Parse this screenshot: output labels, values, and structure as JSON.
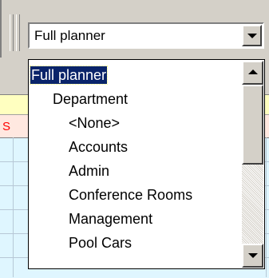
{
  "planner_view": {
    "selected": "Full planner",
    "options": [
      {
        "label": "Full planner",
        "level": 0,
        "selected": true
      },
      {
        "label": "Department",
        "level": 1,
        "selected": false
      },
      {
        "label": "<None>",
        "level": 2,
        "selected": false
      },
      {
        "label": "Accounts",
        "level": 2,
        "selected": false
      },
      {
        "label": "Admin",
        "level": 2,
        "selected": false
      },
      {
        "label": "Conference Rooms",
        "level": 2,
        "selected": false
      },
      {
        "label": "Management",
        "level": 2,
        "selected": false
      },
      {
        "label": "Pool Cars",
        "level": 2,
        "selected": false
      }
    ]
  },
  "background": {
    "row_marker": "S"
  },
  "colors": {
    "selection_bg": "#0a246a",
    "selection_text": "#ffffff",
    "window_face": "#d4d0c8",
    "grid_bg": "#dff6ff",
    "header_yellow": "#ffffc0",
    "marker_red": "#ff0000"
  },
  "icons": {
    "combo_button": "chevron-down-icon",
    "scroll_up": "arrow-up-icon",
    "scroll_down": "arrow-down-icon"
  }
}
